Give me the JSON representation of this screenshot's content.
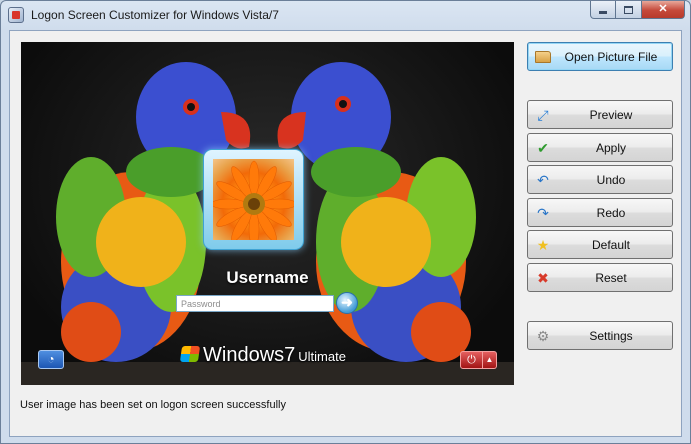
{
  "window": {
    "title": "Logon Screen Customizer for Windows Vista/7",
    "controls": {
      "minimize": "minimize-icon",
      "maximize": "maximize-icon",
      "close": "close-icon"
    }
  },
  "preview": {
    "username": "Username",
    "password_placeholder": "Password",
    "brand": {
      "name": "Windows",
      "version": "7",
      "edition": "Ultimate"
    },
    "go_glyph": "➜",
    "ease_glyph": "◔",
    "power_glyph": "⏻",
    "power_arrow_glyph": "▲"
  },
  "buttons": {
    "open": {
      "label": "Open Picture File",
      "icon": "folder-icon"
    },
    "preview": {
      "label": "Preview",
      "icon": "fullscreen-icon",
      "glyph": "⤢",
      "color": "#2b7fd4"
    },
    "apply": {
      "label": "Apply",
      "icon": "checkmark-icon",
      "glyph": "✔",
      "color": "#2e9b2e"
    },
    "undo": {
      "label": "Undo",
      "icon": "undo-arrow-icon",
      "glyph": "↶",
      "color": "#2a76c8"
    },
    "redo": {
      "label": "Redo",
      "icon": "redo-arrow-icon",
      "glyph": "↷",
      "color": "#2a76c8"
    },
    "default": {
      "label": "Default",
      "icon": "star-icon",
      "glyph": "★",
      "color": "#f0c020"
    },
    "reset": {
      "label": "Reset",
      "icon": "x-mark-icon",
      "glyph": "✖",
      "color": "#d83a2a"
    },
    "settings": {
      "label": "Settings",
      "icon": "gear-icon",
      "glyph": "⚙",
      "color": "#8a8a8a"
    }
  },
  "status": "User image has been set on logon screen successfully"
}
